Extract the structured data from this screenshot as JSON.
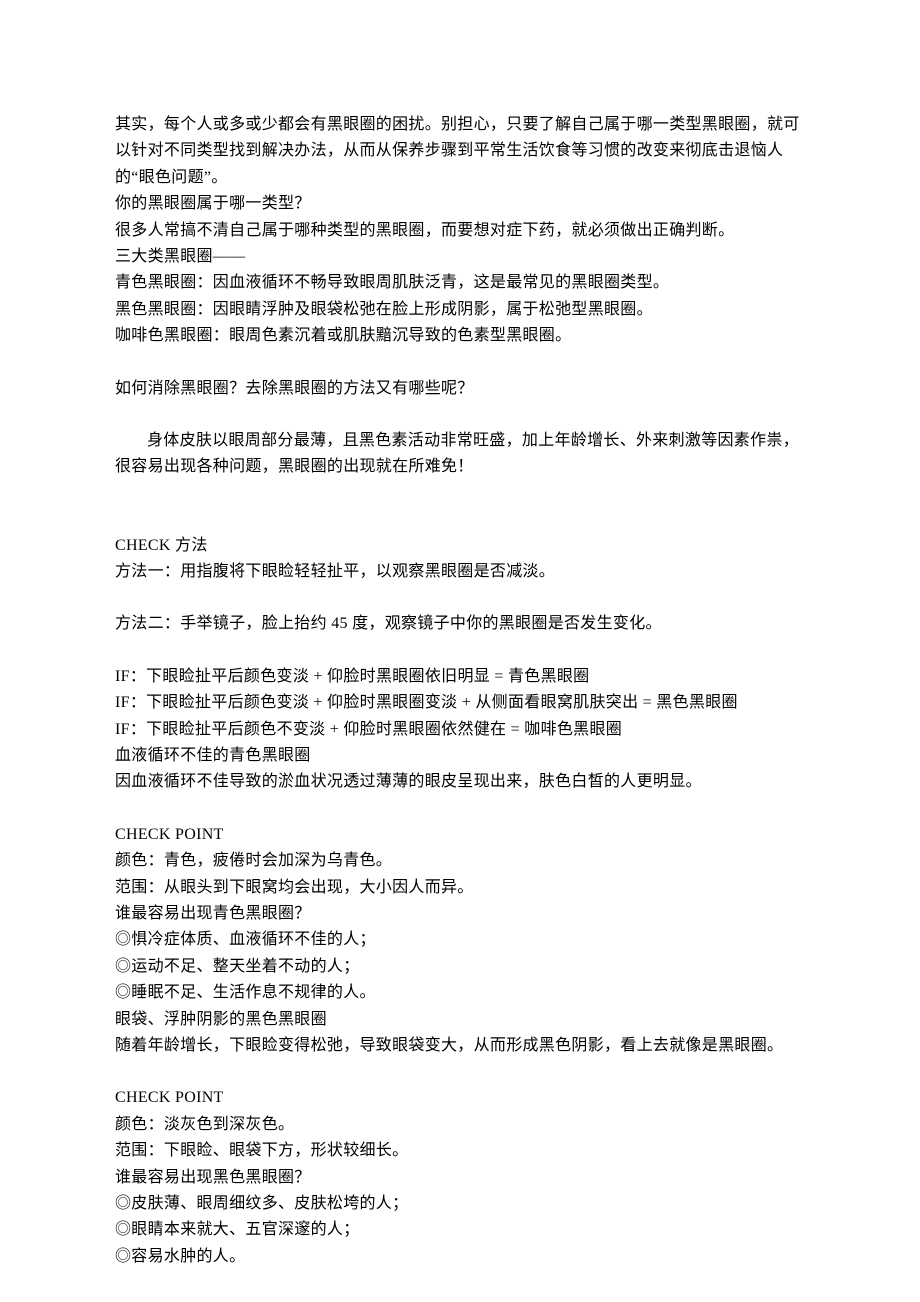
{
  "doc": {
    "intro": "其实，每个人或多或少都会有黑眼圈的困扰。别担心，只要了解自己属于哪一类型黑眼圈，就可以针对不同类型找到解决办法，从而从保养步骤到平常生活饮食等习惯的改变来彻底击退恼人的“眼色问题”。",
    "q1": "你的黑眼圈属于哪一类型？",
    "intro2": "很多人常搞不清自己属于哪种类型的黑眼圈，而要想对症下药，就必须做出正确判断。",
    "types_header": "三大类黑眼圈——",
    "type_blue": "青色黑眼圈：因血液循环不畅导致眼周肌肤泛青，这是最常见的黑眼圈类型。",
    "type_black": "黑色黑眼圈：因眼睛浮肿及眼袋松弛在脸上形成阴影，属于松弛型黑眼圈。",
    "type_coffee": "咖啡色黑眼圈：眼周色素沉着或肌肤黯沉导致的色素型黑眼圈。",
    "q2": "如何消除黑眼圈？去除黑眼圈的方法又有哪些呢？",
    "body_thin": "身体皮肤以眼周部分最薄，且黑色素活动非常旺盛，加上年龄增长、外来刺激等因素作祟，很容易出现各种问题，黑眼圈的出现就在所难免！",
    "check_method_header": "CHECK 方法",
    "method1": "方法一：用指腹将下眼睑轻轻扯平，以观察黑眼圈是否减淡。",
    "method2": "方法二：手举镜子，脸上抬约 45 度，观察镜子中你的黑眼圈是否发生变化。",
    "if1": "IF：下眼睑扯平后颜色变淡 + 仰脸时黑眼圈依旧明显 = 青色黑眼圈",
    "if2": "IF：下眼睑扯平后颜色变淡 + 仰脸时黑眼圈变淡 + 从侧面看眼窝肌肤突出 = 黑色黑眼圈",
    "if3": "IF：下眼睑扯平后颜色不变淡 + 仰脸时黑眼圈依然健在 = 咖啡色黑眼圈",
    "blue_header": "血液循环不佳的青色黑眼圈",
    "blue_desc": "因血液循环不佳导致的淤血状况透过薄薄的眼皮呈现出来，肤色白皙的人更明显。",
    "check_point1": "CHECK POINT",
    "blue_color": "颜色：青色，疲倦时会加深为乌青色。",
    "blue_range": "范围：从眼头到下眼窝均会出现，大小因人而异。",
    "blue_who_q": "谁最容易出现青色黑眼圈？",
    "blue_who1": "◎惧冷症体质、血液循环不佳的人；",
    "blue_who2": "◎运动不足、整天坐着不动的人；",
    "blue_who3": "◎睡眠不足、生活作息不规律的人。",
    "black_header": "眼袋、浮肿阴影的黑色黑眼圈",
    "black_desc": "随着年龄增长，下眼睑变得松弛，导致眼袋变大，从而形成黑色阴影，看上去就像是黑眼圈。",
    "check_point2": "CHECK POINT",
    "black_color": "颜色：淡灰色到深灰色。",
    "black_range": "范围：下眼睑、眼袋下方，形状较细长。",
    "black_who_q": "谁最容易出现黑色黑眼圈？",
    "black_who1": "◎皮肤薄、眼周细纹多、皮肤松垮的人；",
    "black_who2": "◎眼睛本来就大、五官深邃的人；",
    "black_who3": "◎容易水肿的人。"
  }
}
